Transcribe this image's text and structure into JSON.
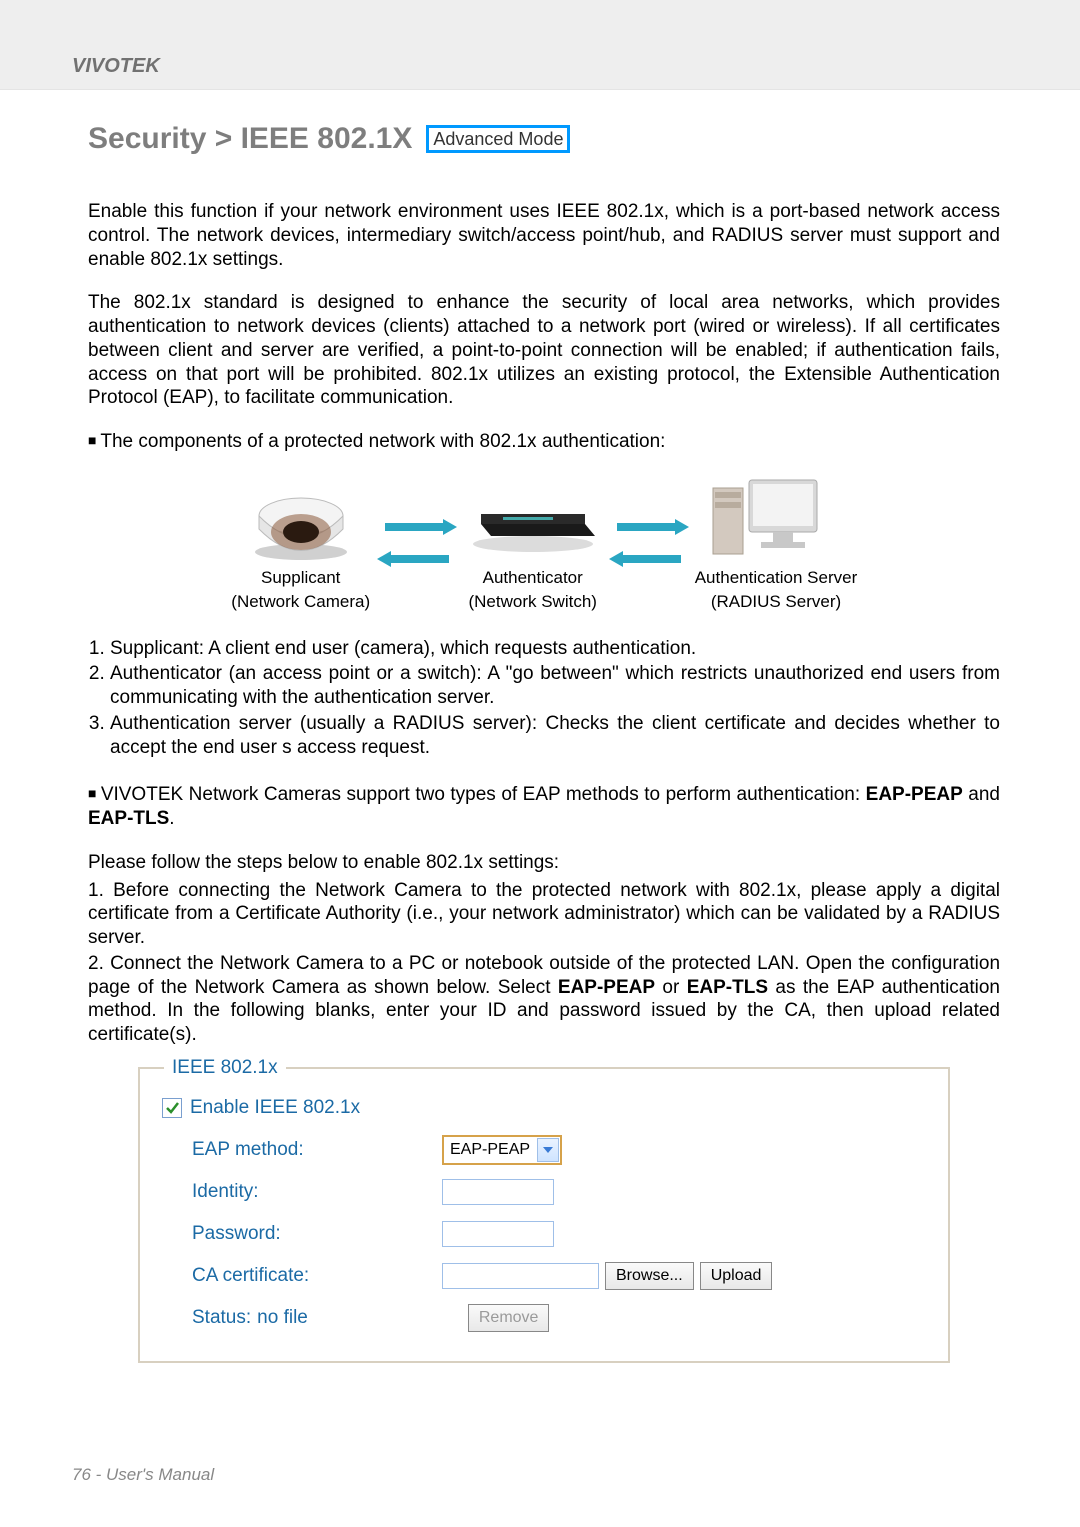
{
  "brand": "VIVOTEK",
  "heading": "Security  >  IEEE 802.1X",
  "mode_badge": "Advanced Mode",
  "para1": "Enable this function if your network environment uses IEEE 802.1x, which is a port-based network access control. The network devices, intermediary switch/access point/hub, and RADIUS server must support and enable 802.1x settings.",
  "para2": "The 802.1x standard is designed to enhance the security of local area networks, which provides authentication to network devices (clients) attached to a network port (wired or wireless). If all certificates between client and server are verified, a point-to-point connection will be enabled; if authentication fails, access on that port will be prohibited. 802.1x utilizes an existing protocol, the Extensible Authentication Protocol (EAP), to facilitate communication.",
  "components_line": "The components of a protected network with 802.1x authentication:",
  "diagram": {
    "supplicant_line1": "Supplicant",
    "supplicant_line2": "(Network Camera)",
    "authenticator_line1": "Authenticator",
    "authenticator_line2": "(Network Switch)",
    "server_line1": "Authentication Server",
    "server_line2": "(RADIUS Server)"
  },
  "numlist": [
    "Supplicant: A client end user (camera), which requests authentication.",
    "Authenticator (an access point or a switch): A \"go between\" which restricts unauthorized end users from communicating with the authentication server.",
    "Authentication server (usually a RADIUS server): Checks the client certificate and decides whether to accept the end user s access request."
  ],
  "support_line_prefix": "VIVOTEK Network Cameras support two types of EAP methods to perform authentication: ",
  "support_bold1": "EAP-PEAP",
  "support_mid": " and ",
  "support_bold2": "EAP-TLS",
  "support_suffix": ".",
  "steps_intro": "Please follow the steps below to enable 802.1x settings:",
  "steps": [
    "Before connecting the Network Camera to the protected network with 802.1x, please apply a digital certificate from a Certificate Authority (i.e., your network administrator) which can be validated by a RADIUS server.",
    {
      "pre": "Connect the Network Camera to a PC or notebook outside of the protected LAN. Open the configuration page of the Network Camera as shown below. Select ",
      "b1": "EAP-PEAP",
      "mid": " or ",
      "b2": "EAP-TLS",
      "post": " as the EAP authentication method. In the following blanks, enter your ID and password issued by the CA, then upload related certificate(s)."
    }
  ],
  "form": {
    "legend": "IEEE 802.1x",
    "enable_label": "Enable IEEE 802.1x",
    "eap_method_label": "EAP method:",
    "eap_method_value": "EAP-PEAP",
    "identity_label": "Identity:",
    "identity_value": "",
    "password_label": "Password:",
    "password_value": "",
    "ca_label": "CA certificate:",
    "ca_value": "",
    "browse_btn": "Browse...",
    "upload_btn": "Upload",
    "status_label": "Status:",
    "status_value": "no file",
    "remove_btn": "Remove"
  },
  "footer": "76 - User's Manual"
}
